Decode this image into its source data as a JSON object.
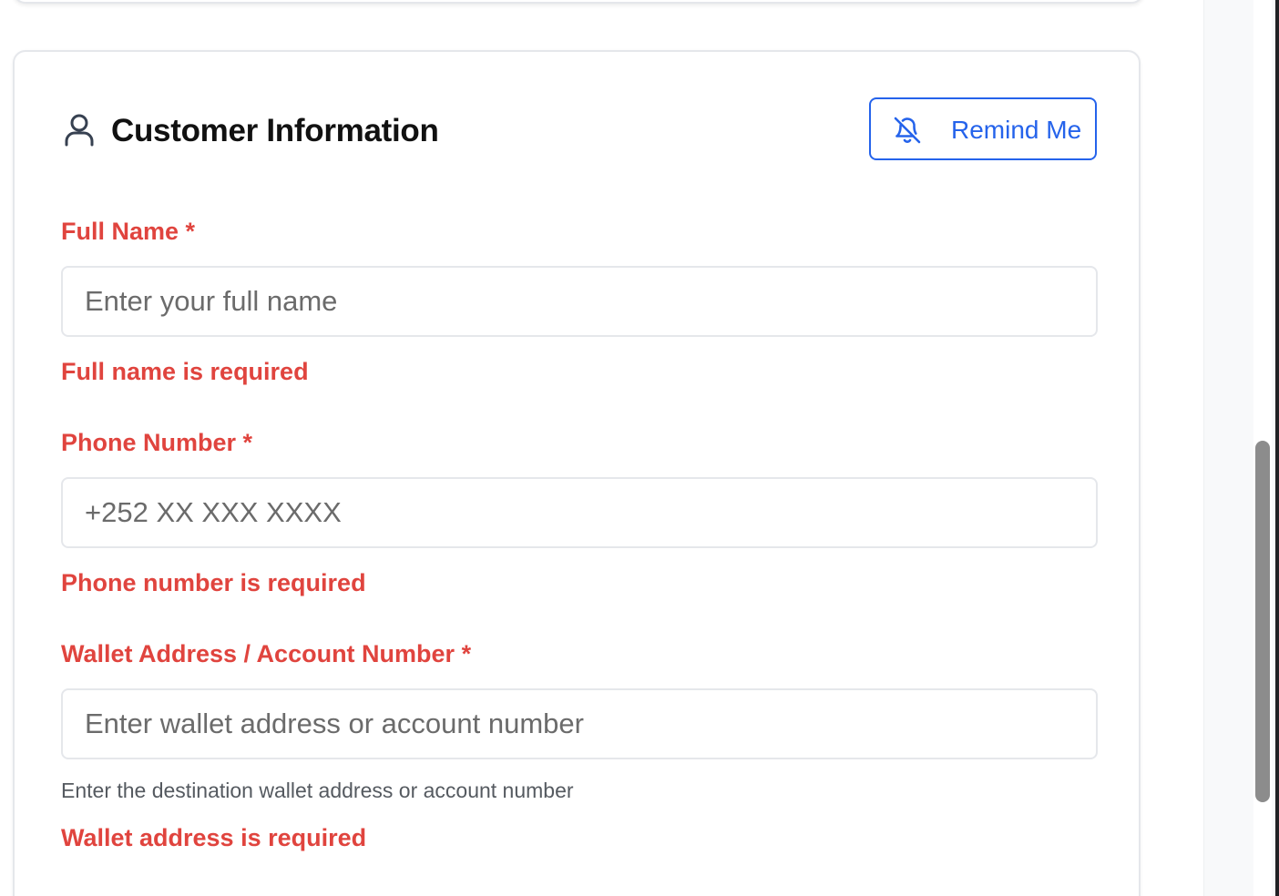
{
  "section": {
    "title": "Customer Information",
    "icon": "user-icon",
    "remind_button": {
      "label": "Remind Me",
      "icon": "bell-off-icon"
    }
  },
  "fields": {
    "full_name": {
      "label": "Full Name *",
      "placeholder": "Enter your full name",
      "value": "",
      "error": "Full name is required"
    },
    "phone": {
      "label": "Phone Number *",
      "placeholder": "+252 XX XXX XXXX",
      "value": "",
      "error": "Phone number is required"
    },
    "wallet": {
      "label": "Wallet Address / Account Number *",
      "placeholder": "Enter wallet address or account number",
      "value": "",
      "help": "Enter the destination wallet address or account number",
      "error": "Wallet address is required"
    }
  },
  "colors": {
    "error": "#e0443e",
    "accent": "#2563eb",
    "border": "#e5e7eb",
    "scroll_thumb": "#8c8c8c"
  }
}
